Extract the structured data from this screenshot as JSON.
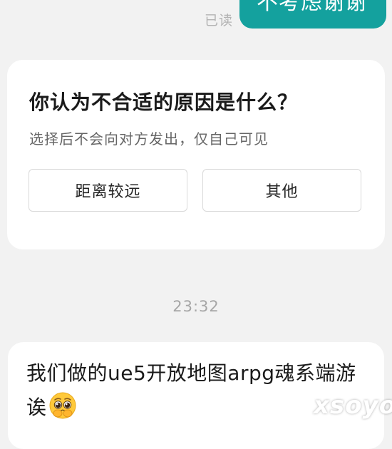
{
  "chat": {
    "outgoing_message_text": "不考虑谢谢",
    "read_status": "已读",
    "timestamp": "23:32",
    "incoming_message_text": "我们做的ue5开放地图arpg魂系端游诶",
    "incoming_emoji": "pleading-face-icon"
  },
  "feedback_card": {
    "title": "你认为不合适的原因是什么？",
    "subtitle": "选择后不会向对方发出，仅自己可见",
    "options": [
      {
        "label": "距离较远"
      },
      {
        "label": "其他"
      }
    ]
  },
  "watermark": "xsoyo",
  "colors": {
    "outgoing_bubble": "#14a19e",
    "background": "#f2f2f2",
    "card": "#ffffff"
  }
}
